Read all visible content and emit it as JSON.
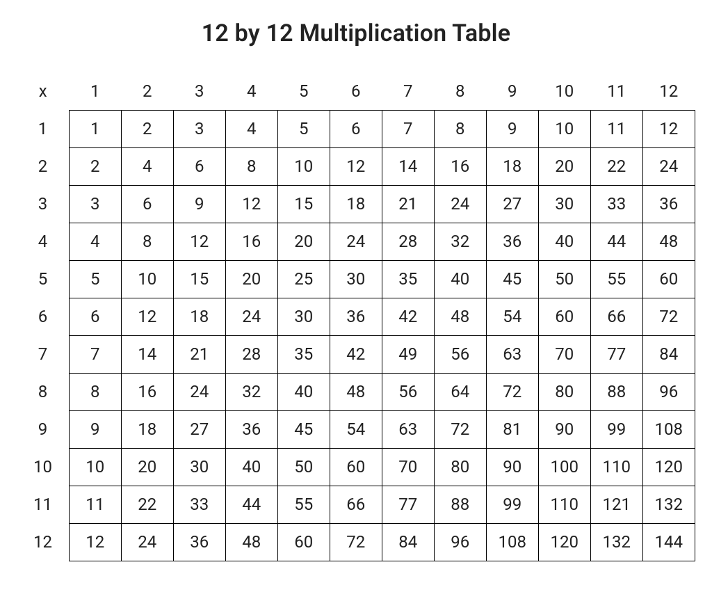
{
  "title": "12 by 12 Multiplication Table",
  "corner": "x",
  "col_headers": [
    "1",
    "2",
    "3",
    "4",
    "5",
    "6",
    "7",
    "8",
    "9",
    "10",
    "11",
    "12"
  ],
  "row_headers": [
    "1",
    "2",
    "3",
    "4",
    "5",
    "6",
    "7",
    "8",
    "9",
    "10",
    "11",
    "12"
  ],
  "rows": [
    [
      "1",
      "2",
      "3",
      "4",
      "5",
      "6",
      "7",
      "8",
      "9",
      "10",
      "11",
      "12"
    ],
    [
      "2",
      "4",
      "6",
      "8",
      "10",
      "12",
      "14",
      "16",
      "18",
      "20",
      "22",
      "24"
    ],
    [
      "3",
      "6",
      "9",
      "12",
      "15",
      "18",
      "21",
      "24",
      "27",
      "30",
      "33",
      "36"
    ],
    [
      "4",
      "8",
      "12",
      "16",
      "20",
      "24",
      "28",
      "32",
      "36",
      "40",
      "44",
      "48"
    ],
    [
      "5",
      "10",
      "15",
      "20",
      "25",
      "30",
      "35",
      "40",
      "45",
      "50",
      "55",
      "60"
    ],
    [
      "6",
      "12",
      "18",
      "24",
      "30",
      "36",
      "42",
      "48",
      "54",
      "60",
      "66",
      "72"
    ],
    [
      "7",
      "14",
      "21",
      "28",
      "35",
      "42",
      "49",
      "56",
      "63",
      "70",
      "77",
      "84"
    ],
    [
      "8",
      "16",
      "24",
      "32",
      "40",
      "48",
      "56",
      "64",
      "72",
      "80",
      "88",
      "96"
    ],
    [
      "9",
      "18",
      "27",
      "36",
      "45",
      "54",
      "63",
      "72",
      "81",
      "90",
      "99",
      "108"
    ],
    [
      "10",
      "20",
      "30",
      "40",
      "50",
      "60",
      "70",
      "80",
      "90",
      "100",
      "110",
      "120"
    ],
    [
      "11",
      "22",
      "33",
      "44",
      "55",
      "66",
      "77",
      "88",
      "99",
      "110",
      "121",
      "132"
    ],
    [
      "12",
      "24",
      "36",
      "48",
      "60",
      "72",
      "84",
      "96",
      "108",
      "120",
      "132",
      "144"
    ]
  ],
  "chart_data": {
    "type": "table",
    "title": "12 by 12 Multiplication Table",
    "columns": [
      1,
      2,
      3,
      4,
      5,
      6,
      7,
      8,
      9,
      10,
      11,
      12
    ],
    "rows_index": [
      1,
      2,
      3,
      4,
      5,
      6,
      7,
      8,
      9,
      10,
      11,
      12
    ],
    "values": [
      [
        1,
        2,
        3,
        4,
        5,
        6,
        7,
        8,
        9,
        10,
        11,
        12
      ],
      [
        2,
        4,
        6,
        8,
        10,
        12,
        14,
        16,
        18,
        20,
        22,
        24
      ],
      [
        3,
        6,
        9,
        12,
        15,
        18,
        21,
        24,
        27,
        30,
        33,
        36
      ],
      [
        4,
        8,
        12,
        16,
        20,
        24,
        28,
        32,
        36,
        40,
        44,
        48
      ],
      [
        5,
        10,
        15,
        20,
        25,
        30,
        35,
        40,
        45,
        50,
        55,
        60
      ],
      [
        6,
        12,
        18,
        24,
        30,
        36,
        42,
        48,
        54,
        60,
        66,
        72
      ],
      [
        7,
        14,
        21,
        28,
        35,
        42,
        49,
        56,
        63,
        70,
        77,
        84
      ],
      [
        8,
        16,
        24,
        32,
        40,
        48,
        56,
        64,
        72,
        80,
        88,
        96
      ],
      [
        9,
        18,
        27,
        36,
        45,
        54,
        63,
        72,
        81,
        90,
        99,
        108
      ],
      [
        10,
        20,
        30,
        40,
        50,
        60,
        70,
        80,
        90,
        100,
        110,
        120
      ],
      [
        11,
        22,
        33,
        44,
        55,
        66,
        77,
        88,
        99,
        110,
        121,
        132
      ],
      [
        12,
        24,
        36,
        48,
        60,
        72,
        84,
        96,
        108,
        120,
        132,
        144
      ]
    ]
  }
}
